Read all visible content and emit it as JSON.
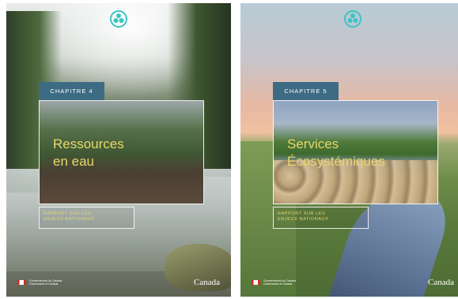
{
  "covers": [
    {
      "chapter": "CHAPITRE 4",
      "title_line1": "Ressources",
      "title_line2": "en eau",
      "report_line1": "RAPPORT SUR LES",
      "report_line2": "ENJEUX NATIONAUX",
      "gov_text": "Gouvernement du Canada   Government of Canada",
      "wordmark": "Canada"
    },
    {
      "chapter": "CHAPITRE 5",
      "title_line1": "Services",
      "title_line2": "Écosystémiques",
      "report_line1": "RAPPORT SUR LES",
      "report_line2": "ENJEUX NATIONAUX",
      "gov_text": "Gouvernement du Canada   Government of Canada",
      "wordmark": "Canada"
    }
  ],
  "colors": {
    "accent_teal": "#3cc4c4",
    "title_yellow": "#e9d76a",
    "label_blue": "#3d6b84"
  },
  "icons": {
    "logo": "leaf-trefoil-icon"
  }
}
